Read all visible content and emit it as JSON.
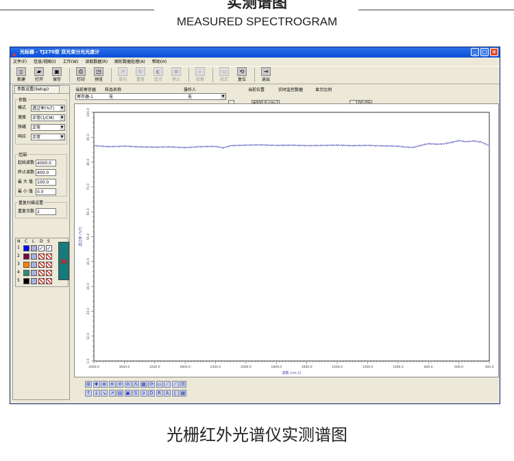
{
  "page": {
    "heading_cn": "实测谱图",
    "heading_en": "MEASURED SPECTROGRAM",
    "caption": "光栅红外光谱仪实测谱图"
  },
  "window": {
    "title": "光标器 - TJ270型 双光束分光光度计"
  },
  "menu": [
    "文件(F)",
    "信息/视图(I)",
    "工作(W)",
    "读取数据(R)",
    "图形数据处理(A)",
    "帮助(H)"
  ],
  "toolbar": [
    {
      "label": "新建",
      "icon": "new-file-icon",
      "enabled": true
    },
    {
      "label": "打开",
      "icon": "open-folder-icon",
      "enabled": true
    },
    {
      "label": "保存",
      "icon": "save-icon",
      "enabled": true
    },
    {
      "label": "打印",
      "icon": "print-icon",
      "enabled": true
    },
    {
      "label": "预览",
      "icon": "preview-icon",
      "enabled": true
    },
    {
      "label": "单扫",
      "icon": "single-scan-icon",
      "enabled": false
    },
    {
      "label": "重复",
      "icon": "repeat-scan-icon",
      "enabled": false
    },
    {
      "label": "定点",
      "icon": "fixed-point-icon",
      "enabled": false
    },
    {
      "label": "停止",
      "icon": "stop-icon",
      "enabled": false
    },
    {
      "label": "检索",
      "icon": "search-icon",
      "enabled": false
    },
    {
      "label": "校正",
      "icon": "calibrate-icon",
      "enabled": false
    },
    {
      "label": "复位",
      "icon": "reset-icon",
      "enabled": true
    },
    {
      "label": "退出",
      "icon": "exit-icon",
      "enabled": true
    }
  ],
  "left_panel": {
    "tab": "参数设置(Setup)",
    "params": {
      "title": "参数",
      "rows": [
        {
          "label": "模式",
          "value": "透过率(%T)"
        },
        {
          "label": "速度",
          "value": "正常(1/CM)"
        },
        {
          "label": "狭缝",
          "value": "正常"
        },
        {
          "label": "响应",
          "value": "正常"
        }
      ]
    },
    "range": {
      "title": "范围",
      "rows": [
        {
          "label": "起始波数",
          "value": "4000.0"
        },
        {
          "label": "终止波数",
          "value": "400.0"
        },
        {
          "label": "最 大 值",
          "value": "100.0"
        },
        {
          "label": "最 小 值",
          "value": "0.0"
        }
      ]
    },
    "repeat": {
      "title": "重复扫描设置",
      "label": "重复次数",
      "value": "2"
    },
    "color_table": {
      "headers": [
        "N",
        "C",
        "L",
        "D",
        "S"
      ],
      "rows": [
        {
          "n": "1",
          "color": "#0000ff",
          "d": true,
          "s": true
        },
        {
          "n": "2",
          "color": "#800040",
          "d": false,
          "s": false
        },
        {
          "n": "3",
          "color": "#ff8000",
          "d": false,
          "s": false
        },
        {
          "n": "4",
          "color": "#2e8b7a",
          "d": false,
          "s": false
        },
        {
          "n": "5",
          "color": "#000000",
          "d": false,
          "s": false
        }
      ]
    }
  },
  "header": {
    "register_label": "当前寄存器",
    "sample_label": "样品名称",
    "operator_label": "操作人",
    "register": "寄存器-1",
    "sample": "无",
    "operator": "无",
    "position_label": "当前位置",
    "monitor_label": "实时监控数据",
    "scale_label": "显示比例",
    "position": "4000.0 cm-1",
    "monitor": "",
    "scale": "100.0%",
    "browse": "..."
  },
  "chart_data": {
    "type": "line",
    "xlabel": "波数 (cm-1)",
    "ylabel": "透过率 (%T)",
    "xlim": [
      4000,
      400
    ],
    "ylim": [
      0,
      100
    ],
    "x_ticks": [
      "4000.0",
      "3600.0",
      "3200.0",
      "2800.0",
      "2400.0",
      "2000.0",
      "1800.0",
      "1600.0",
      "1400.0",
      "1200.0",
      "1000.0",
      "800.0",
      "600.0",
      "400.0"
    ],
    "y_ticks": [
      "0.0",
      "10.0",
      "20.0",
      "30.0",
      "40.0",
      "50.0",
      "60.0",
      "70.0",
      "80.0",
      "90.0",
      "100.0"
    ],
    "line_color": "#6a6acc",
    "x": [
      4000,
      3800,
      3600,
      3400,
      3200,
      3000,
      2800,
      2600,
      2400,
      2300,
      2200,
      2000,
      1900,
      1800,
      1700,
      1600,
      1500,
      1400,
      1300,
      1200,
      1100,
      1000,
      950,
      900,
      850,
      800,
      750,
      700,
      650,
      600,
      550,
      500,
      450,
      400
    ],
    "y": [
      86.6,
      86.2,
      86.4,
      86.1,
      86.0,
      86.1,
      85.8,
      86.2,
      86.3,
      85.7,
      86.6,
      86.8,
      86.9,
      86.7,
      86.8,
      86.6,
      86.7,
      86.8,
      86.6,
      86.7,
      86.5,
      86.4,
      86.0,
      85.9,
      86.7,
      87.4,
      87.2,
      87.3,
      87.9,
      88.6,
      88.2,
      88.5,
      88.0,
      86.5
    ]
  }
}
